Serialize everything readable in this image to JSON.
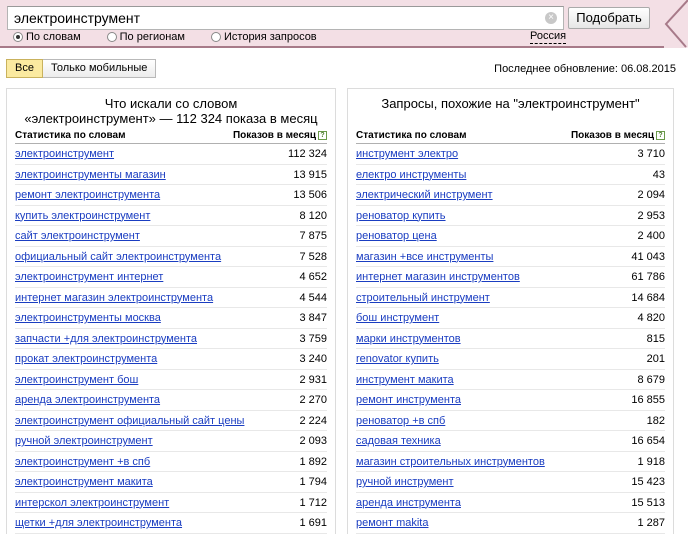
{
  "search": {
    "query": "электроинструмент",
    "clear_glyph": "×",
    "submit_label": "Подобрать"
  },
  "modes": [
    {
      "label": "По словам",
      "selected": true
    },
    {
      "label": "По регионам",
      "selected": false
    },
    {
      "label": "История запросов",
      "selected": false
    }
  ],
  "region": "Россия",
  "filters": [
    "Все",
    "Только мобильные"
  ],
  "updated_label": "Последнее обновление: 06.08.2015",
  "left": {
    "title_line1": "Что искали со словом",
    "title_line2": "«электроинструмент» — 112 324 показа в месяц",
    "col_query": "Статистика по словам",
    "col_count": "Показов в месяц",
    "help_glyph": "?",
    "rows": [
      {
        "q": "электроинструмент",
        "n": "112 324"
      },
      {
        "q": "электроинструменты магазин",
        "n": "13 915"
      },
      {
        "q": "ремонт электроинструмента",
        "n": "13 506"
      },
      {
        "q": "купить электроинструмент",
        "n": "8 120"
      },
      {
        "q": "сайт электроинструмент",
        "n": "7 875"
      },
      {
        "q": "официальный сайт электроинструмента",
        "n": "7 528"
      },
      {
        "q": "электроинструмент интернет",
        "n": "4 652"
      },
      {
        "q": "интернет магазин электроинструмента",
        "n": "4 544"
      },
      {
        "q": "электроинструменты москва",
        "n": "3 847"
      },
      {
        "q": "запчасти +для электроинструмента",
        "n": "3 759"
      },
      {
        "q": "прокат электроинструмента",
        "n": "3 240"
      },
      {
        "q": "электроинструмент бош",
        "n": "2 931"
      },
      {
        "q": "аренда электроинструмента",
        "n": "2 270"
      },
      {
        "q": "электроинструмент официальный сайт цены",
        "n": "2 224"
      },
      {
        "q": "ручной электроинструмент",
        "n": "2 093"
      },
      {
        "q": "электроинструмент +в спб",
        "n": "1 892"
      },
      {
        "q": "электроинструмент макита",
        "n": "1 794"
      },
      {
        "q": "интерскол электроинструмент",
        "n": "1 712"
      },
      {
        "q": "щетки +для электроинструмента",
        "n": "1 691"
      }
    ]
  },
  "right": {
    "title": "Запросы, похожие на \"электроинструмент\"",
    "col_query": "Статистика по словам",
    "col_count": "Показов в месяц",
    "help_glyph": "?",
    "rows": [
      {
        "q": "инструмент электро",
        "n": "3 710"
      },
      {
        "q": "електро инструменты",
        "n": "43"
      },
      {
        "q": "электрический инструмент",
        "n": "2 094"
      },
      {
        "q": "реноватор купить",
        "n": "2 953"
      },
      {
        "q": "реноватор цена",
        "n": "2 400"
      },
      {
        "q": "магазин +все инструменты",
        "n": "41 043"
      },
      {
        "q": "интернет магазин инструментов",
        "n": "61 786"
      },
      {
        "q": "строительный инструмент",
        "n": "14 684"
      },
      {
        "q": "бош инструмент",
        "n": "4 820"
      },
      {
        "q": "марки инструментов",
        "n": "815"
      },
      {
        "q": "renovator купить",
        "n": "201"
      },
      {
        "q": "инструмент макита",
        "n": "8 679"
      },
      {
        "q": "ремонт инструмента",
        "n": "16 855"
      },
      {
        "q": "реноватор +в спб",
        "n": "182"
      },
      {
        "q": "садовая техника",
        "n": "16 654"
      },
      {
        "q": "магазин строительных инструментов",
        "n": "1 918"
      },
      {
        "q": "ручной инструмент",
        "n": "15 423"
      },
      {
        "q": "аренда инструмента",
        "n": "15 513"
      },
      {
        "q": "ремонт makita",
        "n": "1 287"
      }
    ]
  },
  "colors": {
    "header_bg": "#f3dfe5",
    "header_border": "#a77a89",
    "link": "#1a3dc1",
    "active_filter": "#fbeaa0"
  }
}
